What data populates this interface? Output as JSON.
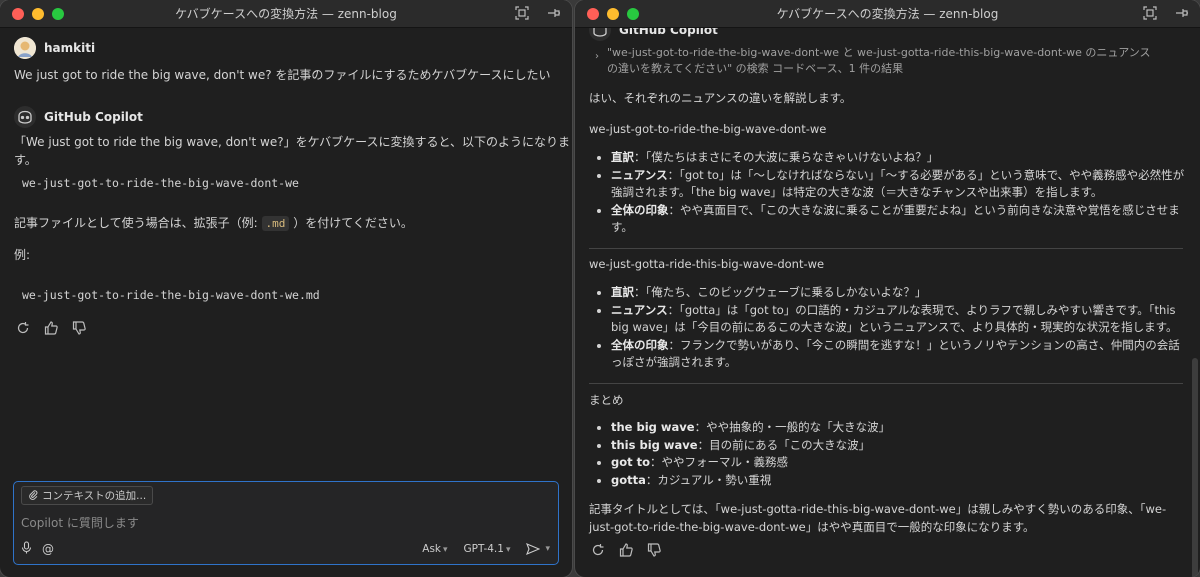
{
  "left_window": {
    "title": "ケバブケースへの変換方法 — zenn-blog",
    "user": {
      "name": "hamkiti",
      "message": "We just got to ride the big wave, don't we? を記事のファイルにするためケバブケースにしたい"
    },
    "copilot": {
      "name": "GitHub Copilot",
      "intro": "「We just got to ride the big wave, don't we?」をケバブケースに変換すると、以下のようになります。",
      "code1": "we-just-got-to-ride-the-big-wave-dont-we",
      "ext_before": "記事ファイルとして使う場合は、拡張子（例:",
      "ext_code": ".md",
      "ext_after": "）を付けてください。",
      "example_label": "例:",
      "code2": "we-just-got-to-ride-the-big-wave-dont-we.md"
    },
    "input": {
      "add_context_label": "コンテキストの追加...",
      "placeholder": "Copilot に質問します",
      "mode_label": "Ask",
      "model_label": "GPT-4.1"
    }
  },
  "right_window": {
    "title": "ケバブケースへの変換方法 — zenn-blog",
    "header_name": "GitHub Copilot",
    "search_ref": "\"we-just-got-to-ride-the-big-wave-dont-we と we-just-gotta-ride-this-big-wave-dont-we のニュアンスの違いを教えてください\" の検索 コードベース、1 件の結果",
    "intro": "はい、それぞれのニュアンスの違いを解説します。",
    "section1": {
      "heading": "we-just-got-to-ride-the-big-wave-dont-we",
      "items": [
        {
          "label": "直訳",
          "text": "：「僕たちはまさにその大波に乗らなきゃいけないよね？」"
        },
        {
          "label": "ニュアンス",
          "text": "：「got to」は「〜しなければならない」「〜する必要がある」という意味で、やや義務感や必然性が強調されます。「the big wave」は特定の大きな波（＝大きなチャンスや出来事）を指します。"
        },
        {
          "label": "全体の印象",
          "text": "：やや真面目で、「この大きな波に乗ることが重要だよね」という前向きな決意や覚悟を感じさせます。"
        }
      ]
    },
    "section2": {
      "heading": "we-just-gotta-ride-this-big-wave-dont-we",
      "items": [
        {
          "label": "直訳",
          "text": "：「俺たち、このビッグウェーブに乗るしかないよな？」"
        },
        {
          "label": "ニュアンス",
          "text": "：「gotta」は「got to」の口語的・カジュアルな表現で、よりラフで親しみやすい響きです。「this big wave」は「今目の前にあるこの大きな波」というニュアンスで、より具体的・現実的な状況を指します。"
        },
        {
          "label": "全体の印象",
          "text": "：フランクで勢いがあり、「今この瞬間を逃すな！」というノリやテンションの高さ、仲間内の会話っぽさが強調されます。"
        }
      ]
    },
    "summary": {
      "heading": "まとめ",
      "items": [
        {
          "label": "the big wave",
          "text": "：やや抽象的・一般的な「大きな波」"
        },
        {
          "label": "this big wave",
          "text": "：目の前にある「この大きな波」"
        },
        {
          "label": "got to",
          "text": "：ややフォーマル・義務感"
        },
        {
          "label": "gotta",
          "text": "：カジュアル・勢い重視"
        }
      ]
    },
    "conclusion": "記事タイトルとしては、「we-just-gotta-ride-this-big-wave-dont-we」は親しみやすく勢いのある印象、「we-just-got-to-ride-the-big-wave-dont-we」はやや真面目で一般的な印象になります。"
  },
  "colors": {
    "accent": "#2f73c9",
    "background": "#1f1f1f",
    "titlebar": "#2b2b2b"
  }
}
